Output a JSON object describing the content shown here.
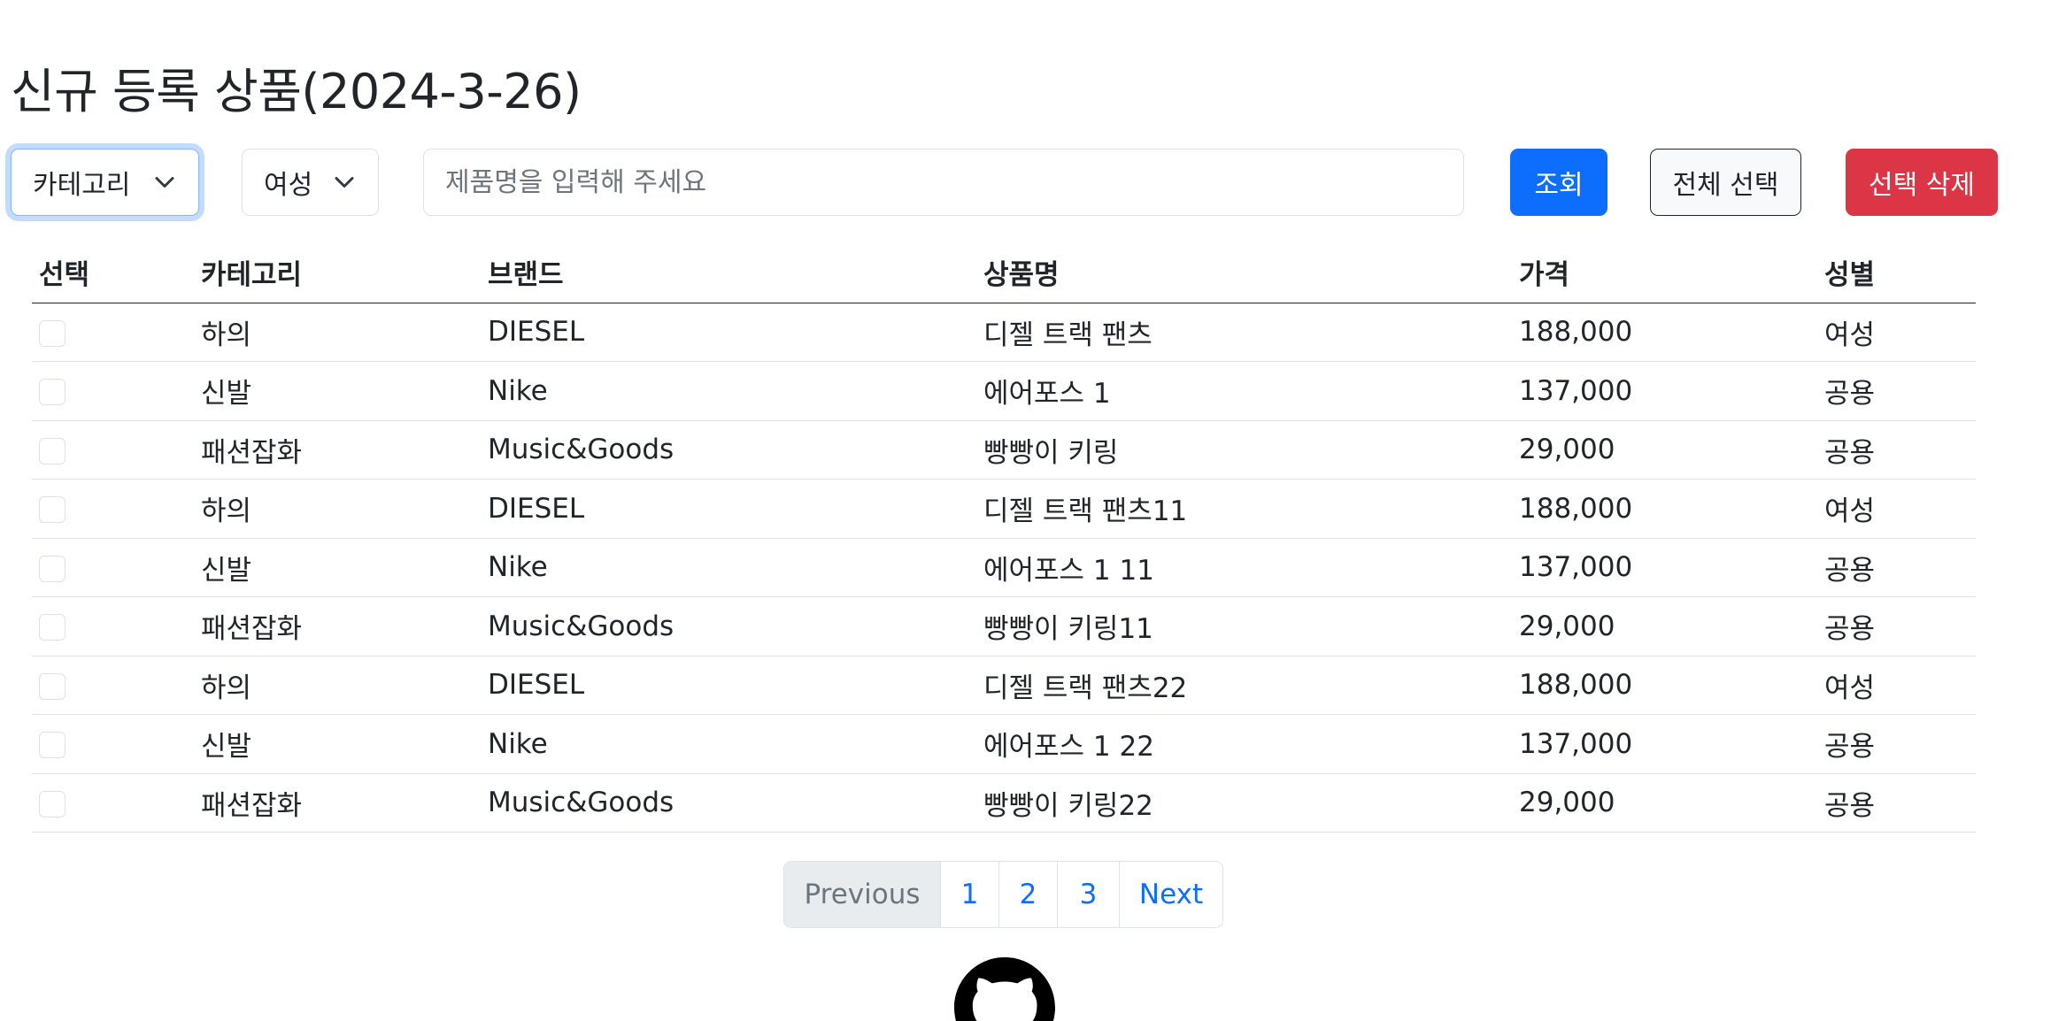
{
  "title": "신규 등록 상품(2024-3-26)",
  "toolbar": {
    "category_select": "카테고리",
    "gender_select": "여성",
    "search_placeholder": "제품명을 입력해 주세요",
    "search_button": "조회",
    "select_all_button": "전체 선택",
    "delete_selected_button": "선택 삭제"
  },
  "table": {
    "headers": {
      "select": "선택",
      "category": "카테고리",
      "brand": "브랜드",
      "name": "상품명",
      "price": "가격",
      "gender": "성별"
    },
    "rows": [
      {
        "category": "하의",
        "brand": "DIESEL",
        "name": "디젤 트랙 팬츠",
        "price": "188,000",
        "gender": "여성"
      },
      {
        "category": "신발",
        "brand": "Nike",
        "name": "에어포스 1",
        "price": "137,000",
        "gender": "공용"
      },
      {
        "category": "패션잡화",
        "brand": "Music&Goods",
        "name": "빵빵이 키링",
        "price": "29,000",
        "gender": "공용"
      },
      {
        "category": "하의",
        "brand": "DIESEL",
        "name": "디젤 트랙 팬츠11",
        "price": "188,000",
        "gender": "여성"
      },
      {
        "category": "신발",
        "brand": "Nike",
        "name": "에어포스 1 11",
        "price": "137,000",
        "gender": "공용"
      },
      {
        "category": "패션잡화",
        "brand": "Music&Goods",
        "name": "빵빵이 키링11",
        "price": "29,000",
        "gender": "공용"
      },
      {
        "category": "하의",
        "brand": "DIESEL",
        "name": "디젤 트랙 팬츠22",
        "price": "188,000",
        "gender": "여성"
      },
      {
        "category": "신발",
        "brand": "Nike",
        "name": "에어포스 1 22",
        "price": "137,000",
        "gender": "공용"
      },
      {
        "category": "패션잡화",
        "brand": "Music&Goods",
        "name": "빵빵이 키링22",
        "price": "29,000",
        "gender": "공용"
      }
    ]
  },
  "pagination": {
    "previous": "Previous",
    "pages": [
      "1",
      "2",
      "3"
    ],
    "next": "Next"
  },
  "icons": {
    "dropdown": "chevron-down-icon",
    "footer": "github-icon"
  },
  "colors": {
    "primary": "#0d6efd",
    "danger": "#dc3545",
    "focus_ring": "#86b7fe",
    "border": "#dee2e6"
  }
}
